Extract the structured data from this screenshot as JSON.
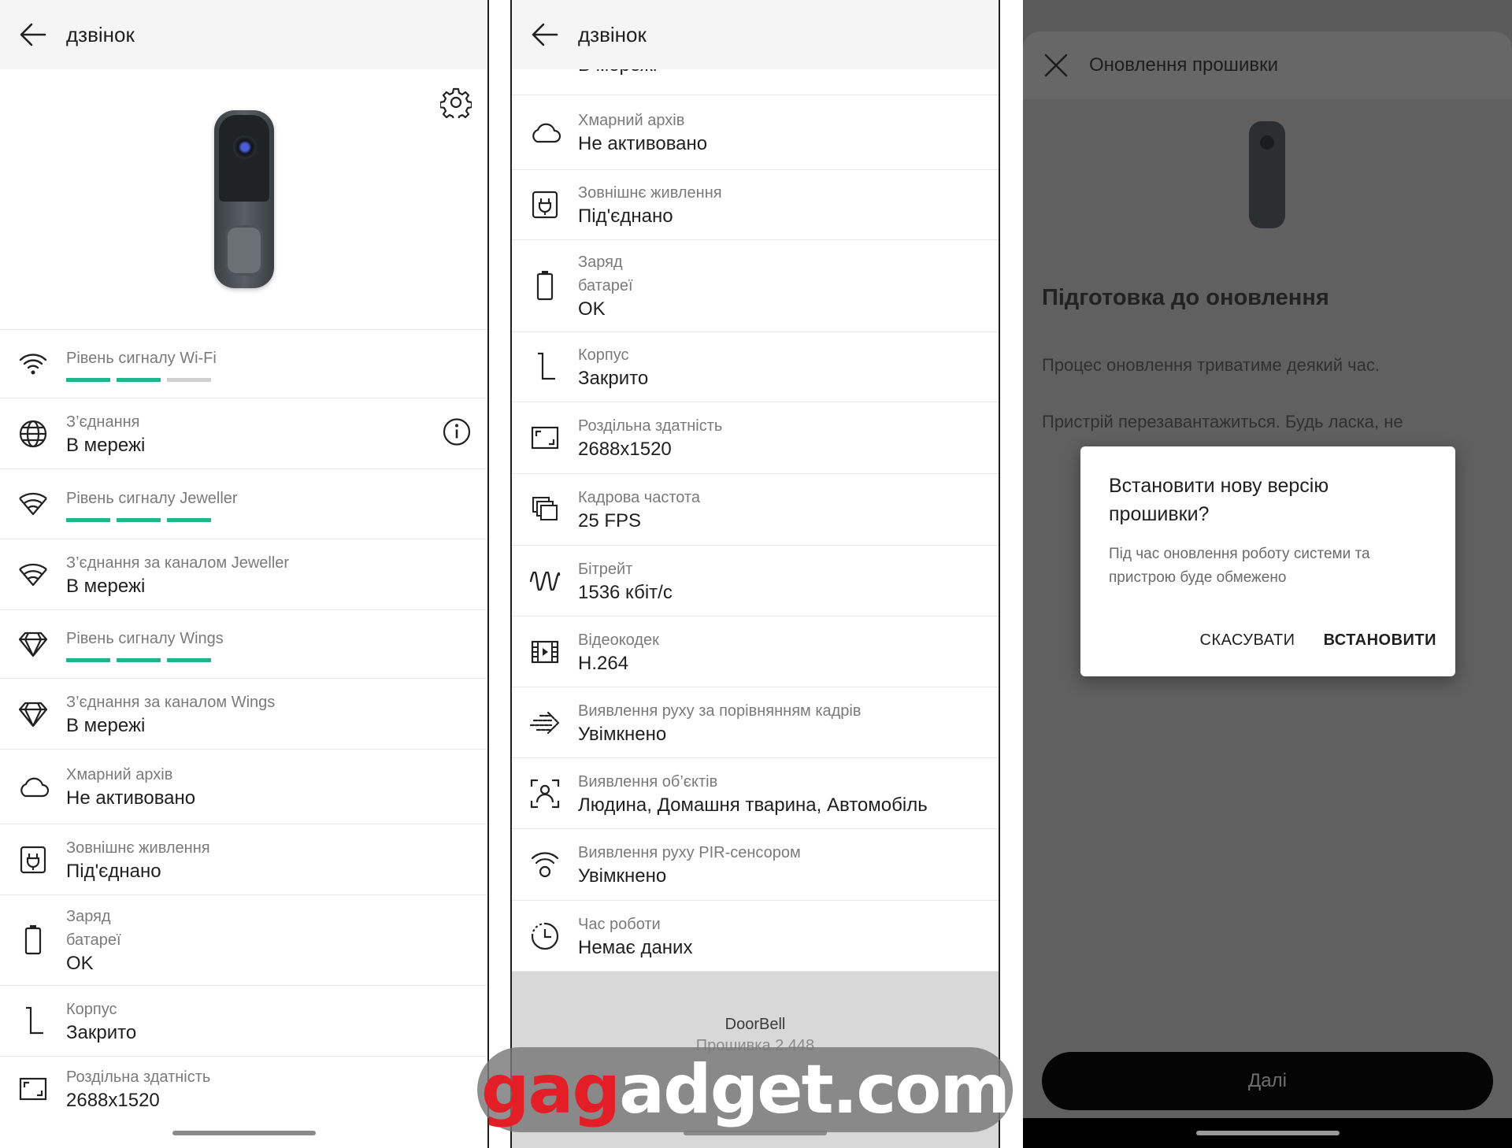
{
  "screen1": {
    "title": "дзвінок",
    "rows": [
      {
        "label": "Рівень сигналу Wi-Fi",
        "bars": 2
      },
      {
        "label": "З’єднання",
        "value": "В мережі"
      },
      {
        "label": "Рівень сигналу Jeweller",
        "bars": 3
      },
      {
        "label": "З’єднання за каналом Jeweller",
        "value": "В мережі"
      },
      {
        "label": "Рівень сигналу Wings",
        "bars": 3
      },
      {
        "label": "З’єднання за каналом Wings",
        "value": "В мережі"
      },
      {
        "label": "Хмарний архів",
        "value": "Не активовано"
      },
      {
        "label": "Зовнішнє живлення",
        "value": "Під'єднано"
      },
      {
        "label": "Заряд",
        "label2": "батареї",
        "value": "OK"
      },
      {
        "label": "Корпус",
        "value": "Закрито"
      },
      {
        "label": "Роздільна здатність",
        "value": "2688x1520"
      }
    ]
  },
  "screen2": {
    "title": "дзвінок",
    "partial_value": "В мережі",
    "rows": [
      {
        "label": "Хмарний архів",
        "value": "Не активовано"
      },
      {
        "label": "Зовнішнє живлення",
        "value": "Під'єднано"
      },
      {
        "label": "Заряд",
        "label2": "батареї",
        "value": "OK"
      },
      {
        "label": "Корпус",
        "value": "Закрито"
      },
      {
        "label": "Роздільна здатність",
        "value": "2688x1520"
      },
      {
        "label": "Кадрова частота",
        "value": "25 FPS"
      },
      {
        "label": "Бітрейт",
        "value": "1536 кбіт/с"
      },
      {
        "label": "Відеокодек",
        "value": "H.264"
      },
      {
        "label": "Виявлення руху за порівнянням кадрів",
        "value": "Увімкнено"
      },
      {
        "label": "Виявлення об’єктів",
        "value": "Людина, Домашня тварина, Автомобіль"
      },
      {
        "label": "Виявлення руху PIR-сенсором",
        "value": "Увімкнено"
      },
      {
        "label": "Час роботи",
        "value": "Немає даних"
      }
    ],
    "footer": {
      "device": "DoorBell",
      "firmware": "Прошивка 2.448"
    }
  },
  "screen3": {
    "sheet_title": "Оновлення прошивки",
    "heading": "Підготовка до оновлення",
    "text1": "Процес оновлення триватиме деякий час.",
    "text2": "Пристрій перезавантажиться. Будь ласка, не",
    "dialog": {
      "title": "Встановити нову версію прошивки?",
      "message": "Під час оновлення роботу системи та пристрою буде обмежено",
      "cancel": "СКАСУВАТИ",
      "confirm": "ВСТАНОВИТИ"
    },
    "next_button": "Далі"
  },
  "watermark": {
    "part1": "ga",
    "part2": "g",
    "part3": "adget.com"
  },
  "colors": {
    "signal_on": "#1fb58f",
    "signal_off": "#d0d0d0"
  }
}
